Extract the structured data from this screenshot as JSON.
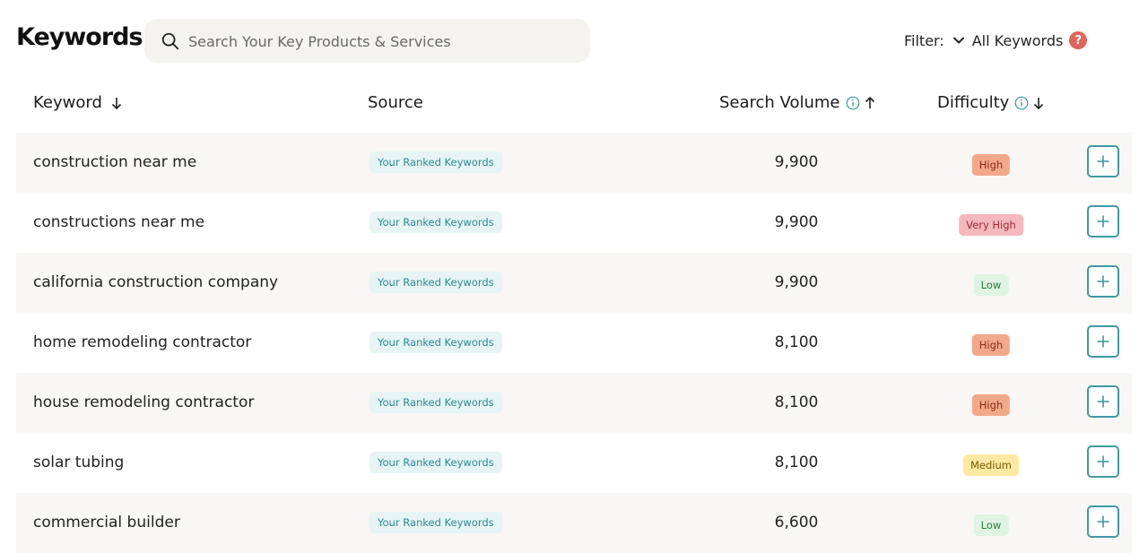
{
  "header": {
    "title": "Keywords",
    "search": {
      "placeholder": "Search Your Key Products & Services",
      "value": ""
    },
    "filter": {
      "label": "Filter:",
      "value": "All Keywords"
    }
  },
  "columns": {
    "keyword": "Keyword",
    "source": "Source",
    "volume": "Search Volume",
    "difficulty": "Difficulty"
  },
  "rows": [
    {
      "keyword": "construction near me",
      "source": "Your Ranked Keywords",
      "volume": "9,900",
      "difficulty": "High"
    },
    {
      "keyword": "constructions near me",
      "source": "Your Ranked Keywords",
      "volume": "9,900",
      "difficulty": "Very High"
    },
    {
      "keyword": "california construction company",
      "source": "Your Ranked Keywords",
      "volume": "9,900",
      "difficulty": "Low"
    },
    {
      "keyword": "home remodeling contractor",
      "source": "Your Ranked Keywords",
      "volume": "8,100",
      "difficulty": "High"
    },
    {
      "keyword": "house remodeling contractor",
      "source": "Your Ranked Keywords",
      "volume": "8,100",
      "difficulty": "High"
    },
    {
      "keyword": "solar tubing",
      "source": "Your Ranked Keywords",
      "volume": "8,100",
      "difficulty": "Medium"
    },
    {
      "keyword": "commercial builder",
      "source": "Your Ranked Keywords",
      "volume": "6,600",
      "difficulty": "Low"
    }
  ],
  "colors": {
    "accent": "#3f9aa0",
    "help": "#e0665a",
    "high": "#f2a989",
    "very_high": "#f5b8bd",
    "low": "#dff4e2",
    "medium": "#fde9a2"
  }
}
